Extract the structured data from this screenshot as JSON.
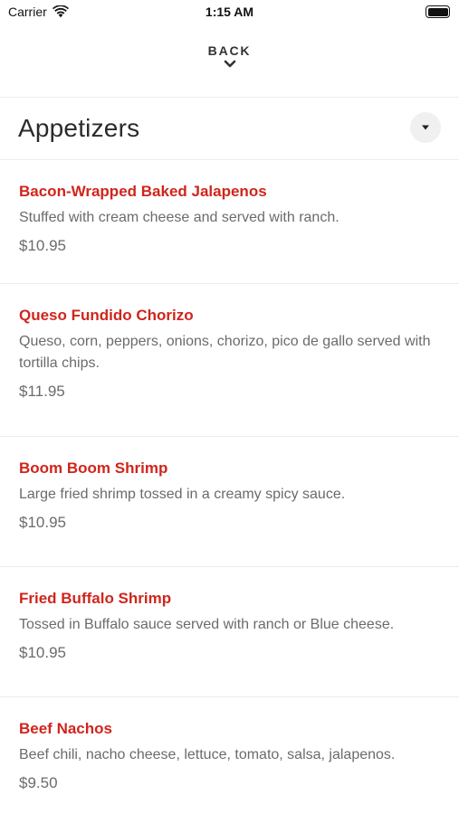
{
  "status_bar": {
    "carrier": "Carrier",
    "time": "1:15 AM"
  },
  "nav": {
    "back_label": "BACK"
  },
  "section": {
    "title": "Appetizers"
  },
  "menu_items": [
    {
      "name": "Bacon-Wrapped Baked Jalapenos",
      "description": "Stuffed with cream cheese and served with ranch.",
      "price": "$10.95"
    },
    {
      "name": "Queso Fundido Chorizo",
      "description": "Queso, corn, peppers, onions, chorizo, pico de gallo served with tortilla chips.",
      "price": "$11.95"
    },
    {
      "name": "Boom Boom Shrimp",
      "description": "Large fried shrimp tossed in a creamy spicy sauce.",
      "price": "$10.95"
    },
    {
      "name": "Fried Buffalo Shrimp",
      "description": "Tossed in Buffalo sauce served with ranch or Blue cheese.",
      "price": "$10.95"
    },
    {
      "name": "Beef Nachos",
      "description": "Beef chili, nacho cheese, lettuce, tomato, salsa, jalapenos.",
      "price": "$9.50"
    }
  ],
  "colors": {
    "item_name": "#d0251c",
    "muted_text": "#6b6b6b",
    "divider": "#ececec"
  }
}
